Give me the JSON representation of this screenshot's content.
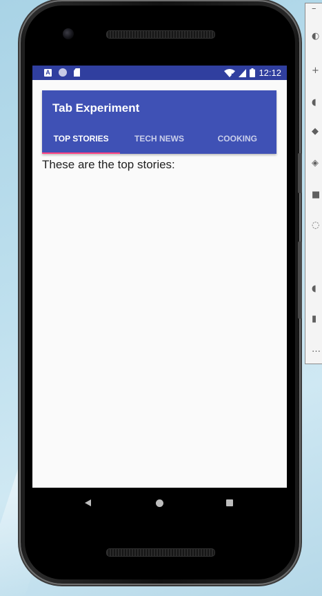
{
  "statusbar": {
    "left_icons": [
      "a-notification-icon",
      "circle-notification-icon",
      "sd-card-icon"
    ],
    "right_icons": [
      "wifi-icon",
      "signal-icon",
      "battery-icon"
    ],
    "time": "12:12",
    "bar_color": "#303f9f"
  },
  "app": {
    "title": "Tab Experiment",
    "primary_color": "#3f51b5",
    "accent_color": "#ff4081"
  },
  "tabs": [
    {
      "label": "TOP STORIES",
      "selected": true
    },
    {
      "label": "TECH NEWS",
      "selected": false
    },
    {
      "label": "COOKING",
      "selected": false
    }
  ],
  "content": {
    "text": "These are the top stories:"
  },
  "navbar": {
    "icons": [
      "back-icon",
      "home-icon",
      "recents-icon"
    ]
  }
}
